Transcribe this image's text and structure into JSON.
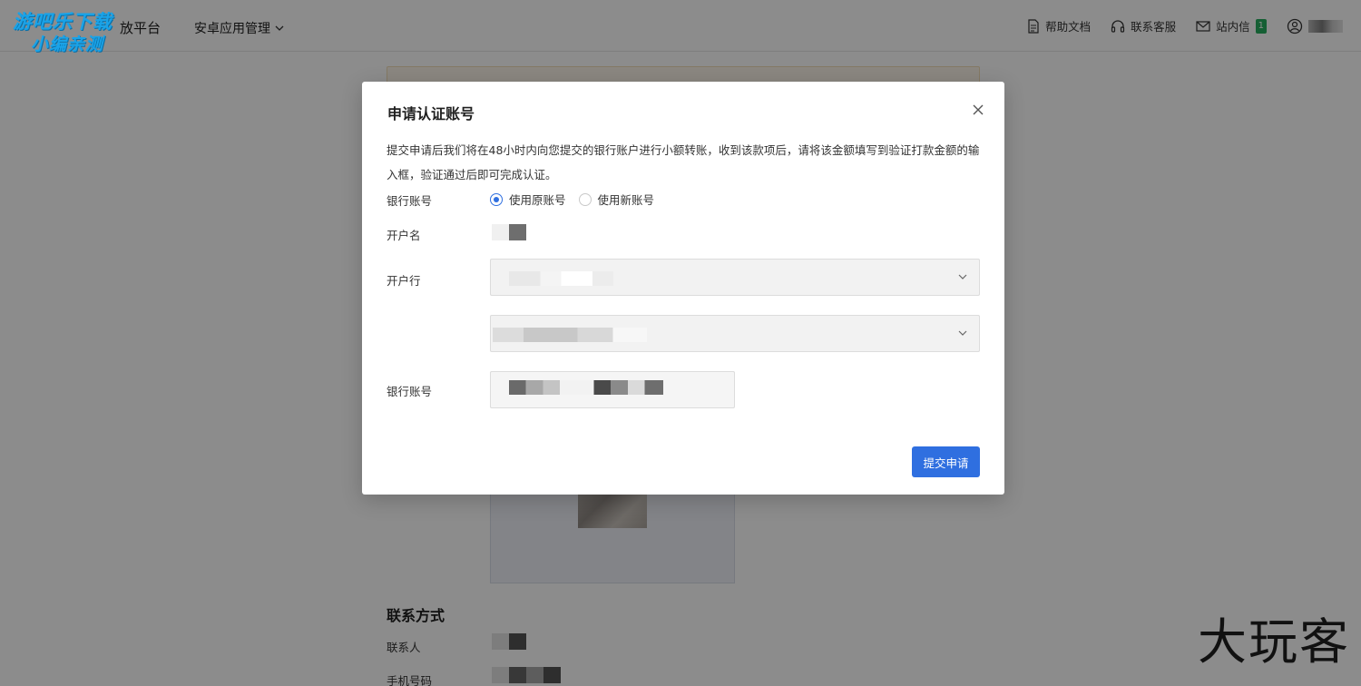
{
  "watermark_top": {
    "line1": "游吧乐下载",
    "line2": "小编亲测"
  },
  "header": {
    "platform_title": "放平台",
    "app_menu": "安卓应用管理",
    "links": {
      "help": "帮助文档",
      "service": "联系客服",
      "inbox": "站内信",
      "inbox_badge": "1"
    }
  },
  "page": {
    "contact_section": "联系方式",
    "contact_person_label": "联系人",
    "phone_label": "手机号码"
  },
  "modal": {
    "title": "申请认证账号",
    "description": "提交申请后我们将在48小时内向您提交的银行账户进行小额转账，收到该款项后，请将该金额填写到验证打款金额的输入框，验证通过后即可完成认证。",
    "bank_account_label": "银行账号",
    "radio_original": "使用原账号",
    "radio_new": "使用新账号",
    "account_name_label": "开户名",
    "bank_label": "开户行",
    "bank_number_label": "银行账号",
    "submit_label": "提交申请"
  },
  "watermark_bottom": "大玩客",
  "colors": {
    "primary": "#2f6fe0",
    "badge": "#27ae60",
    "overlay": "rgba(0,0,0,0.45)"
  }
}
